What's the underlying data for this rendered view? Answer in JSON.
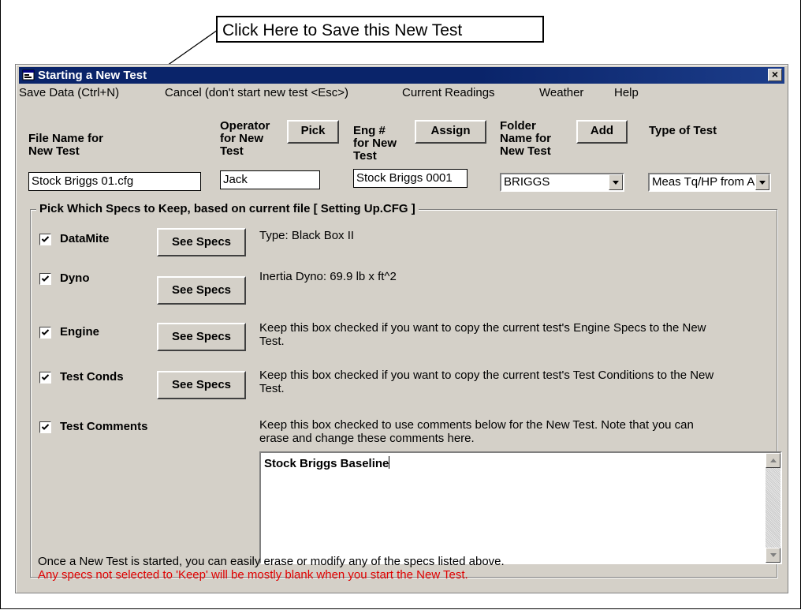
{
  "callout": {
    "text": "Click Here to Save this New Test"
  },
  "window": {
    "title": "Starting a New Test",
    "close_glyph": "×",
    "app_icon": "window-icon"
  },
  "menu": {
    "items": [
      "Save Data (Ctrl+N)",
      "Cancel (don't start new test <Esc>)",
      "Current Readings",
      "Weather",
      "Help"
    ]
  },
  "fields": {
    "file_name": {
      "label_line1": "File Name for",
      "label_line2": "New Test",
      "value": "Stock Briggs 01.cfg"
    },
    "operator": {
      "label_line1": "Operator",
      "label_line2": "for New",
      "label_line3": "Test",
      "value": "Jack",
      "button": "Pick"
    },
    "engine_num": {
      "label_line1": "Eng #",
      "label_line2": "for New",
      "label_line3": "Test",
      "value": "Stock Briggs 0001",
      "button": "Assign"
    },
    "folder": {
      "label_line1": "Folder",
      "label_line2": "Name for",
      "label_line3": "New Test",
      "value": "BRIGGS",
      "button": "Add"
    },
    "test_type": {
      "label": "Type of Test",
      "value": "Meas Tq/HP from Accel"
    }
  },
  "specs_group": {
    "title": "Pick Which Specs to Keep, based on current file [ Setting Up.CFG ]",
    "see_specs_label": "See Specs",
    "rows": [
      {
        "label": "DataMite",
        "checked": true,
        "description": "Type: Black Box II"
      },
      {
        "label": "Dyno",
        "checked": true,
        "description": "Inertia Dyno:  69.9 lb x ft^2"
      },
      {
        "label": "Engine",
        "checked": true,
        "description_line1": "Keep this box checked if you want to copy the current test's Engine Specs to the New",
        "description_line2": "Test."
      },
      {
        "label": "Test Conds",
        "checked": true,
        "description_line1": "Keep this box checked if you want to copy the current test's Test Conditions to the New",
        "description_line2": "Test."
      },
      {
        "label": "Test Comments",
        "checked": true,
        "description_line1": "Keep this box checked to use comments below for the New Test.  Note that you can",
        "description_line2": "erase and change these comments here."
      }
    ],
    "comments_value": "Stock Briggs Baseline"
  },
  "footer": {
    "line1": "Once a New Test is started, you can easily erase or modify any of the specs listed above.",
    "line2": "Any specs not selected to 'Keep' will be mostly blank when you start the New Test.",
    "line2_color": "#e00000"
  }
}
